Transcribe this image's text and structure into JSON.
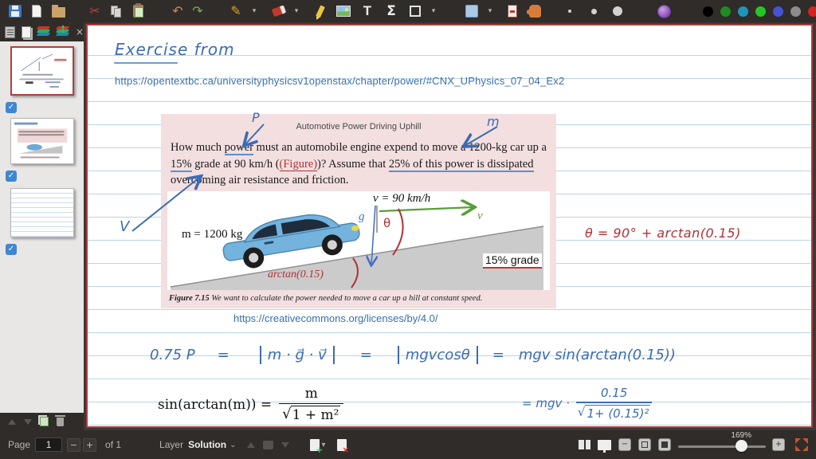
{
  "colors": {
    "toolbar_bg": "#2f2c29",
    "page_border": "#a93c3c",
    "rule_line": "#bdd3e5",
    "exercise_bg": "#f3dfdf",
    "ink_blue": "#3a6cb4",
    "ink_red": "#b03136",
    "ink_green": "#5a9e3a",
    "printed_blue": "#4472c4"
  },
  "toolbar": {
    "icons": {
      "cut": "✂",
      "undo": "↶",
      "redo": "↷",
      "pen": "✎",
      "dropdown": "▾",
      "close": "×",
      "check": "✓",
      "chevron_down": "⌄",
      "minus": "−",
      "plus": "+"
    },
    "text_tool_glyph": "T",
    "math_tool_glyph": "Σ",
    "palette": [
      "#000000",
      "#1f8c1f",
      "#1f96b8",
      "#27c427",
      "#4753d6",
      "#8c8c8c",
      "#d62222",
      "#c428c4",
      "#d8861f",
      "#e3d41f",
      "#ffffff"
    ],
    "palette_square": "#4a86d8"
  },
  "note": {
    "title": "Exercise from",
    "source_url": "https://opentextbc.ca/universityphysicsv1openstax/chapter/power/#CNX_UPhysics_07_04_Ex2",
    "license_url": "https://creativecommons.org/licenses/by/4.0/"
  },
  "exercise": {
    "title": "Automotive Power Driving Uphill",
    "seg1": "How much ",
    "seg_power": "power",
    "seg2": " must an automobile engine expend to move a 1200-kg car up a ",
    "seg_grade": "15%",
    "seg3": " grade at 90 km/h (",
    "seg_figure": "(Figure)",
    "seg4": ")? Assume that ",
    "seg_dissipated": "25% of this power is dissipated",
    "seg5": " overcoming air resistance and friction."
  },
  "figure": {
    "mass_label": "m = 1200 kg",
    "speed_label": "v = 90 km/h",
    "g_label": "g⃗",
    "theta_label": "θ",
    "v_vec_label": "v⃗",
    "arctan_label": "arctan(0.15)",
    "grade_label": "15% grade",
    "caption_lead": "Figure 7.15",
    "caption_text": " We want to calculate the power needed to move a car up a hill at constant speed."
  },
  "annotations": {
    "p_label": "P",
    "m_label": "m",
    "v_label": "V",
    "theta_equation": "θ = 90° + arctan(0.15)",
    "eq_lhs": "0.75 P",
    "eq_sign": "=",
    "eq_t1": "m · g⃗ · v⃗",
    "eq_t2": "mgvcosθ",
    "eq_t3": "mgv sin(arctan(0.15))",
    "identity_lhs": "sin(arctan(m)) =",
    "identity_num": "m",
    "identity_sqrt": "√",
    "identity_radicand": "1 + m²",
    "final_pre": "= mgv ·",
    "final_num": "0.15",
    "final_sqrt": "√",
    "final_radicand": "1+ (0.15)²"
  },
  "statusbar": {
    "page_label": "Page",
    "page_value": "1",
    "of_label": "of 1",
    "layer_label": "Layer",
    "layer_value": "Solution",
    "zoom_value": "169%"
  }
}
